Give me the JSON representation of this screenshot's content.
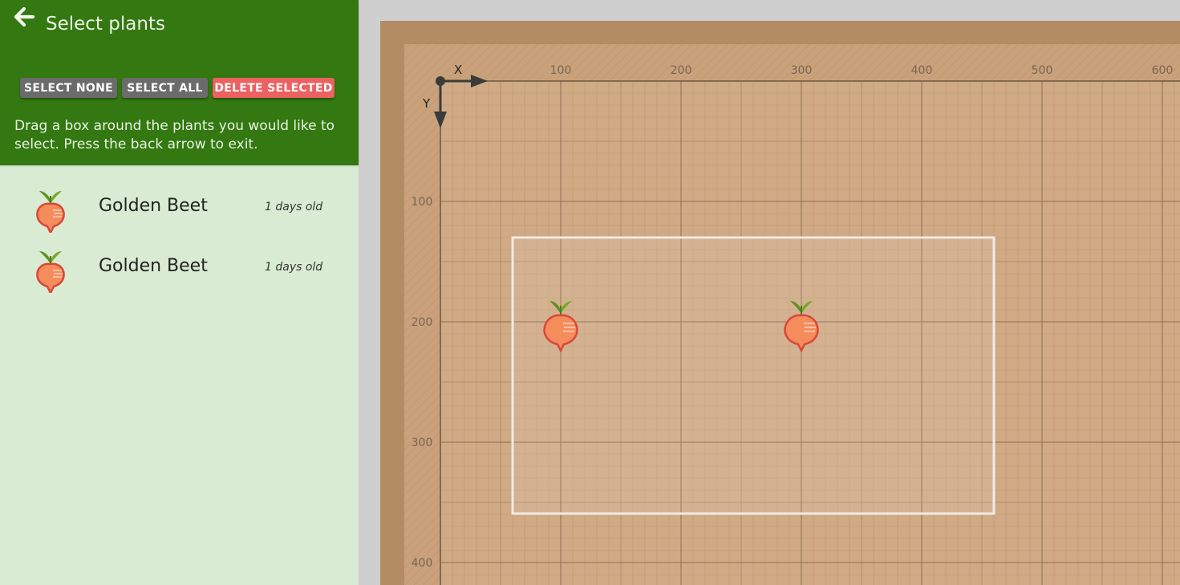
{
  "panel": {
    "title": "Select plants",
    "buttons": {
      "select_none": "SELECT NONE",
      "select_all": "SELECT ALL",
      "delete_selected": "DELETE SELECTED"
    },
    "instructions": "Drag a box around the plants you would like to select. Press the back arrow to exit."
  },
  "plants": [
    {
      "name": "Golden Beet",
      "age": "1 days old"
    },
    {
      "name": "Golden Beet",
      "age": "1 days old"
    }
  ],
  "map": {
    "axis_x_label": "X",
    "axis_y_label": "Y",
    "x_ticks": [
      "100",
      "200",
      "300",
      "400",
      "500",
      "600"
    ],
    "y_ticks": [
      "100",
      "200",
      "300",
      "400"
    ]
  },
  "colors": {
    "header": "#337811",
    "panel": "#d9ebd3",
    "button_gray": "#6b6b6b",
    "button_delete": "#ec6161",
    "map_bed": "#c9a27c",
    "map_border": "#b48c63"
  }
}
